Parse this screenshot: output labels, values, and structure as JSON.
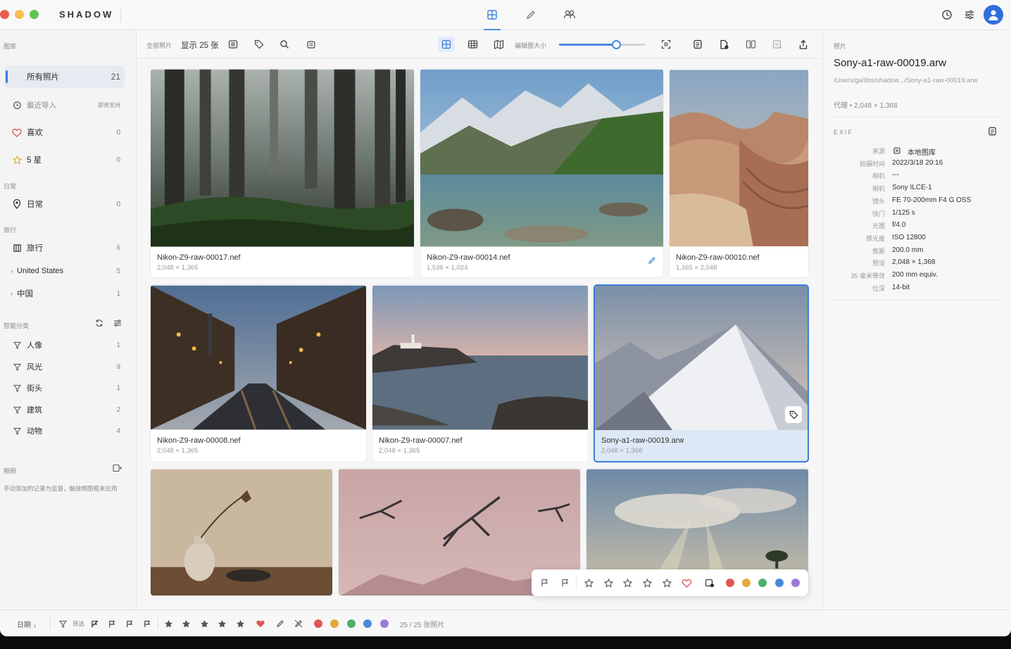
{
  "app": {
    "brand": "SHADOW"
  },
  "colors": {
    "accent": "#3b7dd8",
    "red": "#e05555",
    "orange": "#e5a93a",
    "green": "#4caf6a",
    "blue": "#4a88dc",
    "purple": "#9b7ad8"
  },
  "header": {
    "mode_tabs": [
      "grid-icon",
      "edit-icon",
      "people-icon"
    ],
    "right_icons": [
      "history-icon",
      "sliders-icon",
      "user-avatar"
    ]
  },
  "sidebar": {
    "library_title": "图库",
    "items": [
      {
        "label": "所有照片",
        "count": "21"
      },
      {
        "label": "最近导入",
        "count": "即将支持"
      },
      {
        "label": "喜欢",
        "count": "0"
      },
      {
        "label": "5 星",
        "count": "0"
      }
    ],
    "daily_title": "日常",
    "daily": {
      "label": "日常",
      "count": "0"
    },
    "travel_title": "旅行",
    "travel": {
      "label": "旅行",
      "count": "6"
    },
    "travel_children": [
      {
        "label": "United States",
        "count": "5"
      },
      {
        "label": "中国",
        "count": "1"
      }
    ],
    "smart_title": "智能分类",
    "smart": [
      {
        "label": "人像",
        "count": "1"
      },
      {
        "label": "风光",
        "count": "9"
      },
      {
        "label": "街头",
        "count": "1"
      },
      {
        "label": "建筑",
        "count": "2"
      },
      {
        "label": "动物",
        "count": "4"
      }
    ],
    "album_title": "相册",
    "album_hint": "手动添加的记录为监督，触按频图框来应用"
  },
  "toolbar": {
    "scope": "全部照片",
    "showing": "显示 25 张",
    "size_label": "编辑图大小",
    "thumb_size": 0.67
  },
  "photos": [
    {
      "name": "Nikon-Z9-raw-00017.nef",
      "dims": "2,048 × 1,365"
    },
    {
      "name": "Nikon-Z9-raw-00014.nef",
      "dims": "1,536 × 1,024"
    },
    {
      "name": "Nikon-Z9-raw-00010.nef",
      "dims": "1,365 × 2,048"
    },
    {
      "name": "Nikon-Z9-raw-00008.nef",
      "dims": "2,048 × 1,365"
    },
    {
      "name": "Nikon-Z9-raw-00007.nef",
      "dims": "2,048 × 1,365"
    },
    {
      "name": "Sony-a1-raw-00019.arw",
      "dims": "2,048 × 1,368"
    }
  ],
  "inspector": {
    "section": "照片",
    "filename": "Sony-a1-raw-00019.arw",
    "path": "/Users/ga/libs/shadow.../Sony-a1-raw-00019.arw",
    "proxy_label": "代理",
    "proxy_value": "• 2,048 × 1,368",
    "exif_title": "EXIF",
    "exif": [
      {
        "k": "来源",
        "v": "本地图库"
      },
      {
        "k": "拍摄时间",
        "v": "2022/3/18 20:16"
      },
      {
        "k": "相机",
        "v": "---"
      },
      {
        "k": "相机",
        "v": "Sony ILCE-1"
      },
      {
        "k": "镜头",
        "v": "FE 70-200mm F4 G OSS"
      },
      {
        "k": "快门",
        "v": "1/125 s"
      },
      {
        "k": "光圈",
        "v": "f/4.0"
      },
      {
        "k": "感光度",
        "v": "ISO 12800"
      },
      {
        "k": "焦距",
        "v": "200.0 mm"
      },
      {
        "k": "预设",
        "v": "2,048 × 1,368"
      },
      {
        "k": "35 毫米等效",
        "v": "200 mm equiv."
      },
      {
        "k": "位深",
        "v": "14-bit"
      }
    ]
  },
  "bottombar": {
    "sort": "日期 ↓",
    "filter": "筛选",
    "count": "25 / 25 张照片"
  }
}
